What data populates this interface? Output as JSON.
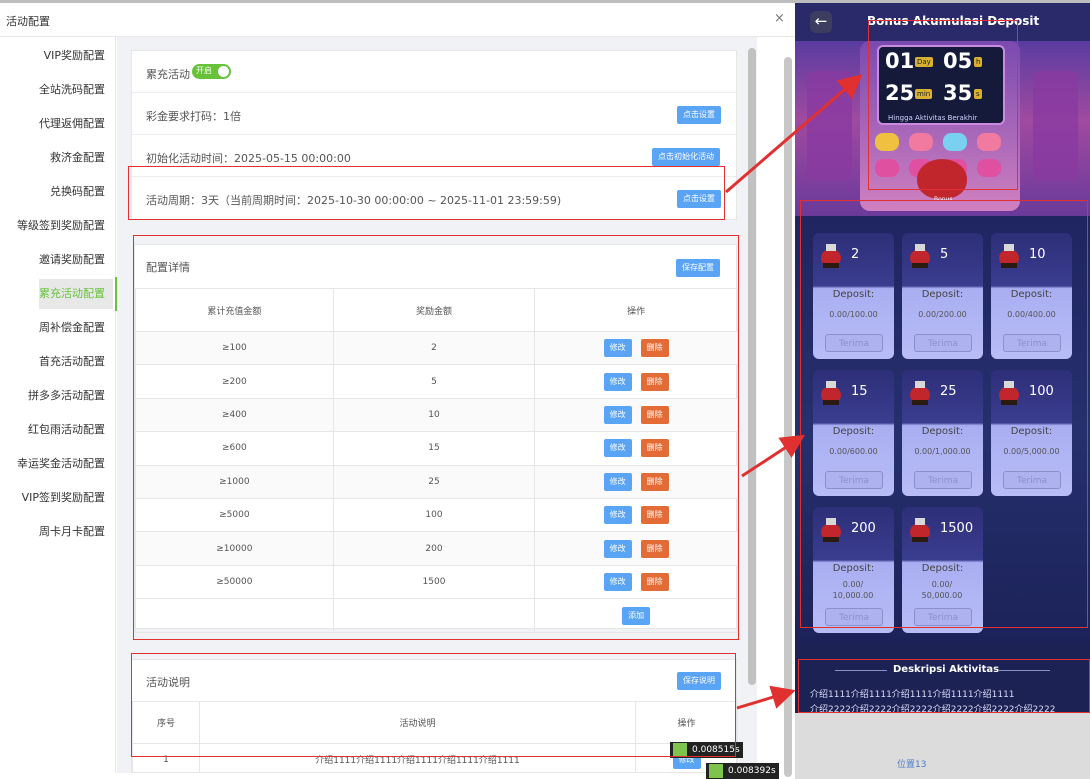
{
  "dialog": {
    "title": "活动配置",
    "close": "×"
  },
  "sidebar": {
    "items": [
      "VIP奖励配置",
      "全站洗码配置",
      "代理返佣配置",
      "救济金配置",
      "兑换码配置",
      "等级签到奖励配置",
      "邀请奖励配置",
      "累充活动配置",
      "周补偿金配置",
      "首充活动配置",
      "拼多多活动配置",
      "红包雨活动配置",
      "幸运奖金活动配置",
      "VIP签到奖励配置",
      "周卡月卡配置"
    ],
    "active_index": 7
  },
  "activity": {
    "name": "累充活动",
    "switch_label": "开启",
    "wager_text": "彩金要求打码：1倍",
    "wager_button": "点击设置",
    "init_time_text": "初始化活动时间：2025-05-15 00:00:00",
    "init_button": "点击初始化活动",
    "cycle_text": "活动周期：3天（当前周期时间：2025-10-30 00:00:00 ~ 2025-11-01 23:59:59)",
    "cycle_button": "点击设置"
  },
  "config": {
    "title": "配置详情",
    "save_button": "保存配置",
    "headers": [
      "累计充值金额",
      "奖励金额",
      "操作"
    ],
    "rows": [
      {
        "amount": "≥100",
        "reward": "2"
      },
      {
        "amount": "≥200",
        "reward": "5"
      },
      {
        "amount": "≥400",
        "reward": "10"
      },
      {
        "amount": "≥600",
        "reward": "15"
      },
      {
        "amount": "≥1000",
        "reward": "25"
      },
      {
        "amount": "≥5000",
        "reward": "100"
      },
      {
        "amount": "≥10000",
        "reward": "200"
      },
      {
        "amount": "≥50000",
        "reward": "1500"
      }
    ],
    "edit_label": "修改",
    "delete_label": "删除",
    "add_label": "添加"
  },
  "description": {
    "title": "活动说明",
    "save_button": "保存说明",
    "headers": [
      "序号",
      "活动说明",
      "操作"
    ],
    "row": {
      "index": "1",
      "text": "介绍1111介绍1111介绍1111介绍1111介绍1111",
      "action": "修改"
    }
  },
  "phone": {
    "title": "Bonus Akumulasi Deposit",
    "timer": {
      "days": "01",
      "day_unit": "Day",
      "hours": "05",
      "hour_unit": "h",
      "minutes": "25",
      "minute_unit": "min",
      "seconds": "35",
      "second_unit": "s",
      "caption": "Hingga Aktivitas Berakhir"
    },
    "bag_label": "Bonus",
    "tiles": [
      {
        "value": "2",
        "deposit": "Deposit:",
        "progress": "0.00/100.00",
        "button": "Terima"
      },
      {
        "value": "5",
        "deposit": "Deposit:",
        "progress": "0.00/200.00",
        "button": "Terima"
      },
      {
        "value": "10",
        "deposit": "Deposit:",
        "progress": "0.00/400.00",
        "button": "Terima"
      },
      {
        "value": "15",
        "deposit": "Deposit:",
        "progress": "0.00/600.00",
        "button": "Terima"
      },
      {
        "value": "25",
        "deposit": "Deposit:",
        "progress": "0.00/1,000.00",
        "button": "Terima"
      },
      {
        "value": "100",
        "deposit": "Deposit:",
        "progress": "0.00/5,000.00",
        "button": "Terima"
      },
      {
        "value": "200",
        "deposit": "Deposit:",
        "progress": "0.00/ 10,000.00",
        "button": "Terima"
      },
      {
        "value": "1500",
        "deposit": "Deposit:",
        "progress": "0.00/ 50,000.00",
        "button": "Terima"
      }
    ],
    "desc_title": "Deskripsi Aktivitas",
    "desc_lines": [
      "介绍1111介绍1111介绍1111介绍1111介绍1111",
      "介绍2222介绍2222介绍2222介绍2222介绍2222介绍2222"
    ]
  },
  "bottom_label": "位置13",
  "timings": [
    "0.008515s",
    "0.008392s"
  ],
  "colors": {
    "accent_blue": "#5aa4f6",
    "danger": "#e36b35",
    "active_green": "#67c23a",
    "annotation_red": "#e03030"
  }
}
